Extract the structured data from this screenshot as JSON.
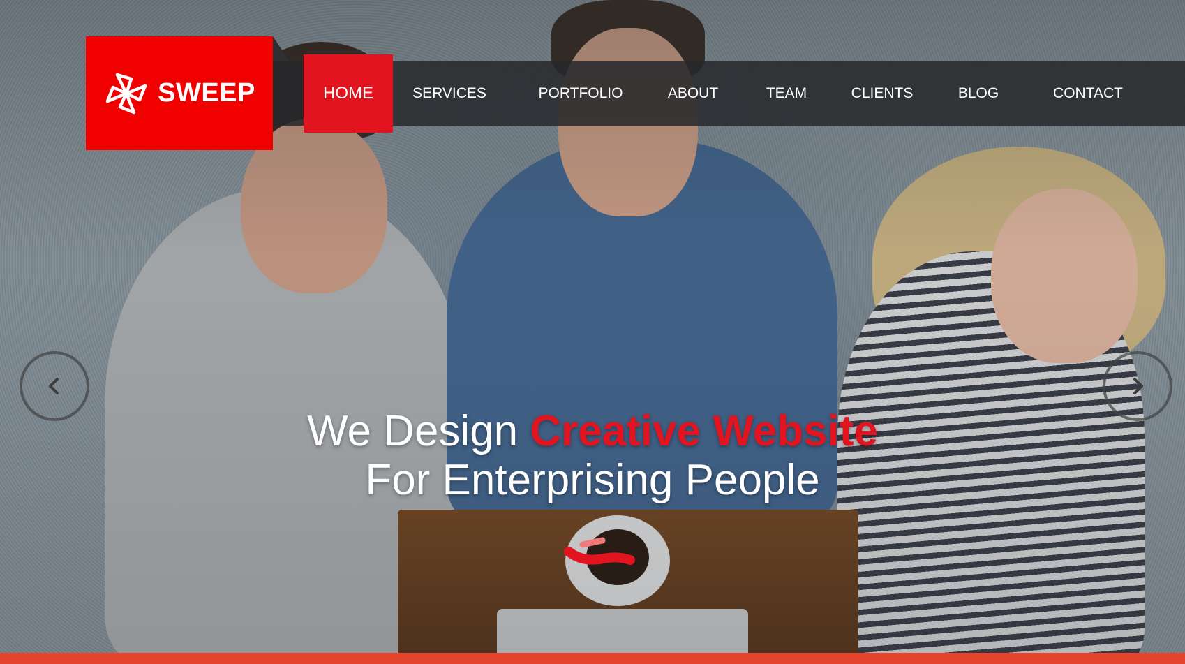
{
  "brand": {
    "name": "SWEEP",
    "color": "#f10000",
    "icon": "pinwheel-logo-icon"
  },
  "nav": {
    "items": [
      {
        "label": "HOME",
        "active": true
      },
      {
        "label": "SERVICES",
        "active": false
      },
      {
        "label": "PORTFOLIO",
        "active": false
      },
      {
        "label": "ABOUT",
        "active": false
      },
      {
        "label": "TEAM",
        "active": false
      },
      {
        "label": "CLIENTS",
        "active": false
      },
      {
        "label": "BLOG",
        "active": false
      },
      {
        "label": "CONTACT",
        "active": false
      }
    ],
    "active_color": "#e2141f"
  },
  "hero": {
    "line1_prefix": "We Design",
    "line1_accent": "Creative Website",
    "line2": "For Enterprising People",
    "accent_color": "#e2141f",
    "prev_icon": "chevron-left-icon",
    "next_icon": "chevron-right-icon",
    "scroll_icon": "scroll-down-icon"
  },
  "footer_bar": {
    "color": "#e6452d"
  }
}
